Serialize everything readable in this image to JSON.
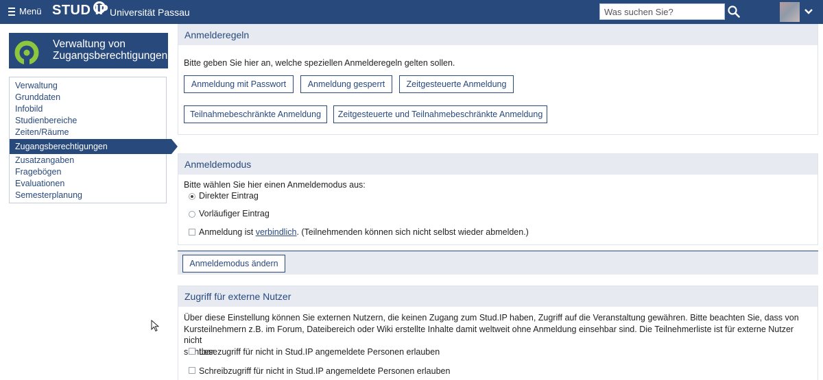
{
  "topbar": {
    "menu_label": "Menü",
    "logo_text": "STUD IP",
    "university": "Universität Passau",
    "search_placeholder": "Was suchen Sie?"
  },
  "sidebar": {
    "title": "Verwaltung von Zugangsberechtigungen",
    "items": [
      {
        "label": "Verwaltung",
        "active": false
      },
      {
        "label": "Grunddaten",
        "active": false
      },
      {
        "label": "Infobild",
        "active": false
      },
      {
        "label": "Studienbereiche",
        "active": false
      },
      {
        "label": "Zeiten/Räume",
        "active": false
      },
      {
        "label": "Zugangsberechtigungen",
        "active": true
      },
      {
        "label": "Zusatzangaben",
        "active": false
      },
      {
        "label": "Fragebögen",
        "active": false
      },
      {
        "label": "Evaluationen",
        "active": false
      },
      {
        "label": "Semesterplanung",
        "active": false
      }
    ]
  },
  "anmelderegeln": {
    "title": "Anmelderegeln",
    "description": "Bitte geben Sie hier an, welche speziellen Anmelderegeln gelten sollen.",
    "buttons": [
      "Anmeldung mit Passwort",
      "Anmeldung gesperrt",
      "Zeitgesteuerte Anmeldung",
      "Teilnahmebeschränkte Anmeldung",
      "Zeitgesteuerte und Teilnahmebeschränkte Anmeldung"
    ]
  },
  "anmeldemodus": {
    "title": "Anmeldemodus",
    "description": "Bitte wählen Sie hier einen Anmeldemodus aus:",
    "options": [
      {
        "label": "Direkter Eintrag",
        "selected": true
      },
      {
        "label": "Vorläufiger Eintrag",
        "selected": false
      }
    ],
    "verbindlich_prefix": "Anmeldung ist ",
    "verbindlich_link": "verbindlich",
    "verbindlich_suffix": ". (Teilnehmenden können sich nicht selbst wieder abmelden.)",
    "verbindlich_checked": false,
    "change_button": "Anmeldemodus ändern"
  },
  "extern": {
    "title": "Zugriff für externe Nutzer",
    "description_lines": [
      "Über diese Einstellung können Sie externen Nutzern, die keinen Zugang zum Stud.IP haben, Zugriff auf die Veranstaltung gewähren. Bitte beachten Sie, dass von",
      "Kursteilnehmern z.B. im Forum, Dateibereich oder Wiki erstellte Inhalte damit weltweit ohne Anmeldung einsehbar sind. Die Teilnehmerliste ist für externe Nutzer nicht",
      "sichtbar."
    ],
    "options": [
      {
        "label": "Lesezugriff für nicht in Stud.IP angemeldete Personen erlauben",
        "checked": false
      },
      {
        "label": "Schreibzugriff für nicht in Stud.IP angemeldete Personen erlauben",
        "checked": false
      }
    ]
  },
  "colors": {
    "brand": "#28497c",
    "panel_header": "#e7ebf1"
  }
}
